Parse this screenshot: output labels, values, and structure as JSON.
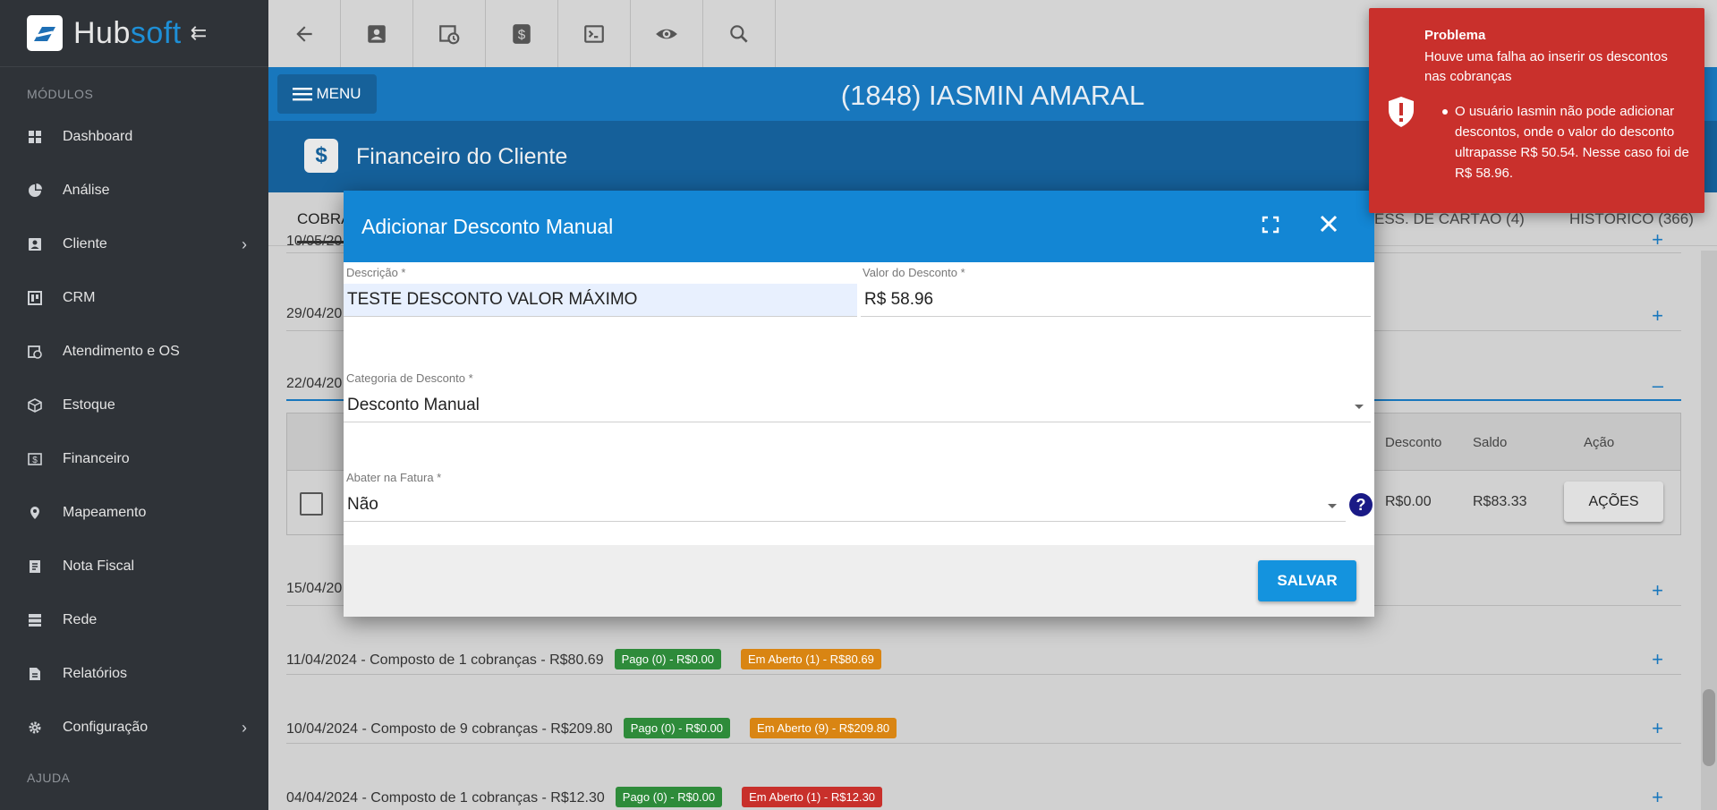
{
  "brand": {
    "name_main": "Hub",
    "name_accent": "soft"
  },
  "sidebar": {
    "section_modules": "MÓDULOS",
    "section_help": "AJUDA",
    "items": [
      {
        "label": "Dashboard",
        "icon": "grid-icon"
      },
      {
        "label": "Análise",
        "icon": "pie-chart-icon"
      },
      {
        "label": "Cliente",
        "icon": "contact-card-icon"
      },
      {
        "label": "CRM",
        "icon": "board-icon"
      },
      {
        "label": "Atendimento e OS",
        "icon": "calendar-clock-icon"
      },
      {
        "label": "Estoque",
        "icon": "box-icon"
      },
      {
        "label": "Financeiro",
        "icon": "money-icon"
      },
      {
        "label": "Mapeamento",
        "icon": "map-pin-icon"
      },
      {
        "label": "Nota Fiscal",
        "icon": "document-icon"
      },
      {
        "label": "Rede",
        "icon": "server-icon"
      },
      {
        "label": "Relatórios",
        "icon": "report-icon"
      },
      {
        "label": "Configuração",
        "icon": "gear-icon"
      }
    ]
  },
  "header": {
    "menu_label": "MENU",
    "client_name": "(1848) IASMIN AMARAL",
    "page_title": "Financeiro do Cliente",
    "page_icon": "$"
  },
  "tabs": {
    "first": "COBRA",
    "cartao": "ESS. DE CARTÃO (4)",
    "historico": "HISTÓRICO (366)"
  },
  "rows": {
    "r0": "10/05/20",
    "r1": "29/04/20",
    "r2": "22/04/20",
    "r3": "15/04/20",
    "r4": {
      "text": "11/04/2024 - Composto de 1 cobranças - R$80.69",
      "paid": "Pago (0) - R$0.00",
      "open": "Em Aberto (1) - R$80.69"
    },
    "r5": {
      "text": "10/04/2024 - Composto de 9 cobranças - R$209.80",
      "paid": "Pago (0) - R$0.00",
      "open": "Em Aberto (9) - R$209.80"
    },
    "r6": {
      "text": "04/04/2024 - Composto de 1 cobranças - R$12.30",
      "paid": "Pago (0) - R$0.00",
      "open": "Em Aberto (1) - R$12.30"
    }
  },
  "subtable": {
    "headers": {
      "desconto": "Desconto",
      "saldo": "Saldo",
      "acao": "Ação"
    },
    "row": {
      "desconto": "R$0.00",
      "saldo": "R$83.33",
      "acoes": "AÇÕES"
    }
  },
  "modal": {
    "title": "Adicionar Desconto Manual",
    "descricao_label": "Descrição *",
    "descricao_value": "TESTE DESCONTO VALOR MÁXIMO",
    "valor_label": "Valor do Desconto *",
    "valor_value": "R$ 58.96",
    "categoria_label": "Categoria de Desconto *",
    "categoria_value": "Desconto Manual",
    "abater_label": "Abater na Fatura *",
    "abater_value": "Não",
    "help": "?",
    "save": "SALVAR"
  },
  "toast": {
    "title": "Problema",
    "message": "Houve uma falha ao inserir os descontos nas cobranças",
    "detail": "O usuário Iasmin não pode adicionar descontos, onde o valor do desconto ultrapasse R$ 50.54. Nesse caso foi de R$ 58.96.",
    "color": "#c9302c"
  }
}
